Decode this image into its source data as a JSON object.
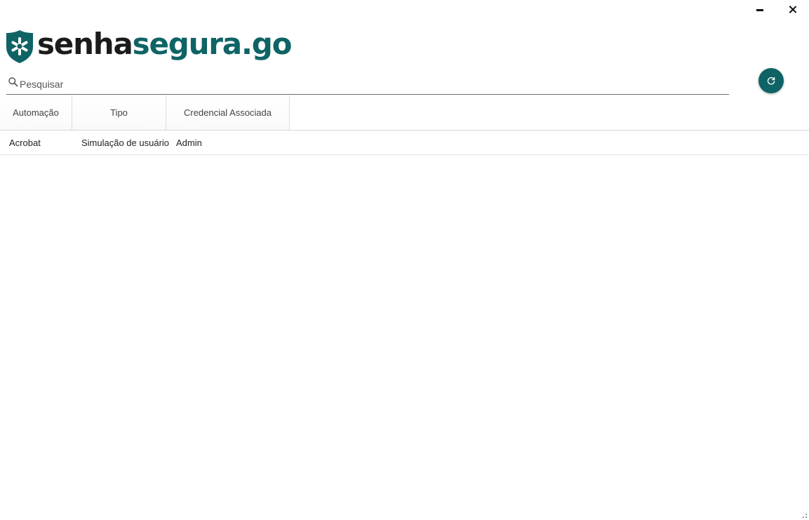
{
  "window": {
    "minimize_icon": "minimize-icon",
    "close_icon": "close-icon"
  },
  "logo": {
    "text_part1": "senha",
    "text_part2": "segura.go",
    "icon": "shield-asterisk-icon"
  },
  "search": {
    "placeholder": "Pesquisar",
    "value": "",
    "icon": "search-icon"
  },
  "refresh": {
    "icon": "refresh-icon"
  },
  "table": {
    "columns": [
      "Automação",
      "Tipo",
      "Credencial Associada"
    ],
    "rows": [
      [
        "Acrobat",
        "Simulação de usuário",
        "Admin"
      ]
    ]
  },
  "colors": {
    "brand": "#0f6365",
    "text_dark": "#1b1b1b"
  }
}
